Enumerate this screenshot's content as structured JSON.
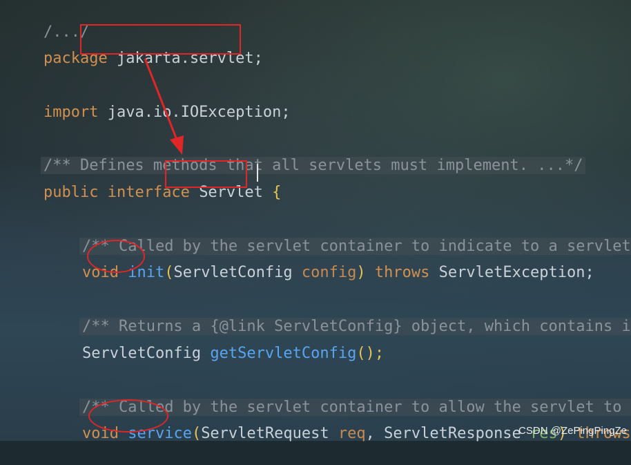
{
  "lines": {
    "l1": "/.../",
    "l2_kw": "package",
    "l2_pkg": "jakarta.servlet;",
    "l3_kw": "import",
    "l3_rest": "java.io.IOException;",
    "l4_comment": "/** Defines methods that all servlets must implement. ...*/",
    "l5_kw1": "public",
    "l5_kw2": "interface",
    "l5_name": "Servlet",
    "l5_brace": "{",
    "l6_comment": "/** Called by the servlet container to indicate to a servlet",
    "l7_void": "void",
    "l7_fn": "init",
    "l7_p1": "(",
    "l7_type": "ServletConfig",
    "l7_param": "config",
    "l7_p2": ")",
    "l7_throws": "throws",
    "l7_exc": "ServletException;",
    "l8_comment": "/** Returns a {@link ServletConfig} object, which contains in",
    "l9_type": "ServletConfig",
    "l9_fn": "getServletConfig",
    "l9_tail": "();",
    "l10_comment": "/** Called by the servlet container to allow the servlet to r",
    "l11_void": "void",
    "l11_fn": "service",
    "l11_p1": "(",
    "l11_type1": "ServletRequest",
    "l11_param1": "req",
    "l11_comma": ",",
    "l11_type2": "ServletResponse",
    "l11_param2": "res",
    "l11_p2": ")",
    "l11_throws": "throws"
  },
  "watermark": "CSDN @ZePingPingZe",
  "colors": {
    "annotation": "#e02626",
    "keyword": "#d2914f",
    "function": "#5aa5f0",
    "comment": "#8a939b"
  }
}
